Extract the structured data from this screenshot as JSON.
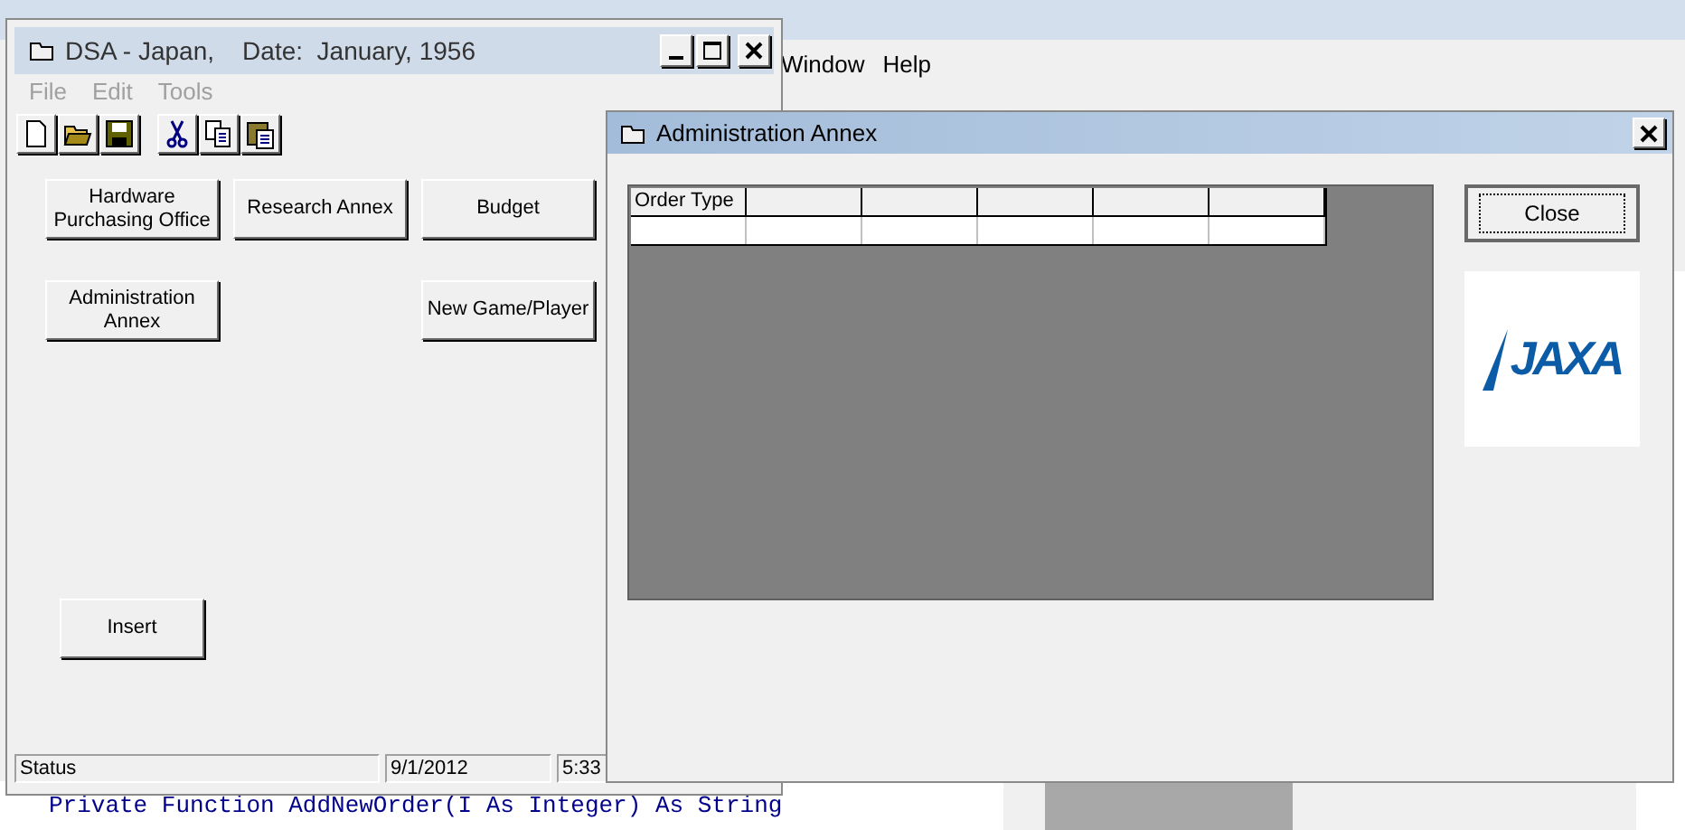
{
  "ide": {
    "menu": [
      {
        "label": "Window"
      },
      {
        "label": "Help"
      }
    ],
    "code_line": "Private Function AddNewOrder(I As Integer) As String"
  },
  "main_window": {
    "title": "DSA - Japan,    Date:  January, 1956",
    "menu": [
      {
        "label": "File",
        "disabled": true
      },
      {
        "label": "Edit",
        "disabled": true
      },
      {
        "label": "Tools",
        "disabled": true
      }
    ],
    "toolbar": [
      {
        "kind": "new"
      },
      {
        "kind": "open"
      },
      {
        "kind": "save"
      },
      {
        "kind": "cut"
      },
      {
        "kind": "copy"
      },
      {
        "kind": "paste"
      }
    ],
    "buttons": [
      {
        "label": "Hardware Purchasing Office"
      },
      {
        "label": "Research Annex"
      },
      {
        "label": "Budget"
      },
      {
        "label": "Administration Annex"
      },
      {
        "label": "New Game/Player"
      },
      {
        "label": "Insert"
      }
    ],
    "status_bar": [
      "Status",
      "9/1/2012",
      "5:33"
    ]
  },
  "admin_window": {
    "title": "Administration Annex",
    "grid": {
      "columns": [
        "Order Type"
      ]
    },
    "close_button": "Close",
    "logo": "JAXA"
  }
}
